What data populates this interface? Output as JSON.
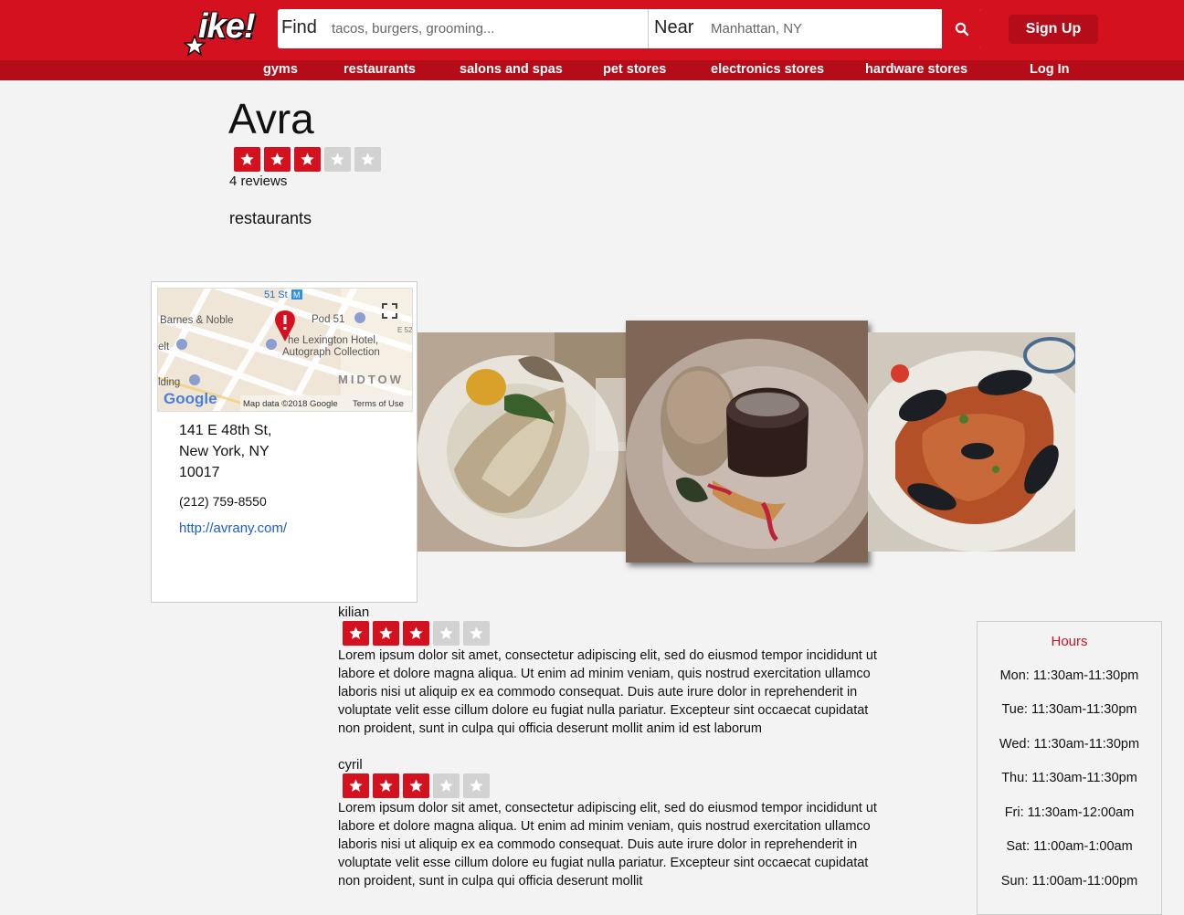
{
  "colors": {
    "brand_red": "#d4121f",
    "dark_red": "#b40d19",
    "star_off": "#d2d2d2",
    "link_blue": "#1a5fc7"
  },
  "header": {
    "logo_text": "ike!",
    "find_label": "Find",
    "find_placeholder": "tacos, burgers, grooming...",
    "near_label": "Near",
    "near_placeholder": "Manhattan, NY",
    "search_icon": "search-icon",
    "signup_label": "Sign Up"
  },
  "nav": {
    "items": [
      "gyms",
      "restaurants",
      "salons and spas",
      "pet stores",
      "electronics stores",
      "hardware stores"
    ],
    "login_label": "Log In"
  },
  "business": {
    "name": "Avra",
    "rating": 3,
    "rating_max": 5,
    "reviews_count": "4 reviews",
    "category": "restaurants",
    "address_line1": "141 E 48th St,",
    "address_line2": "New York, NY",
    "address_line3": "10017",
    "phone": "(212) 759-8550",
    "website": "http://avrany.com/"
  },
  "map": {
    "labels": {
      "street": "51 St",
      "store": "Barnes & Noble",
      "pod": "Pod 51",
      "hotel_line1": "he Lexington Hotel,",
      "hotel_line2": "Autograph Collection",
      "area": "MIDTOW",
      "left1": "elt",
      "left2": "lding",
      "e52": "E 52",
      "google": "Google",
      "attribution": "Map data ©2018 Google",
      "terms": "Terms of Use",
      "metro": "M"
    }
  },
  "photos": [
    {
      "name": "fish-dish-photo"
    },
    {
      "name": "lava-cake-photo"
    },
    {
      "name": "seafood-pasta-photo"
    }
  ],
  "reviews": [
    {
      "user": "kilian",
      "rating": 3,
      "text": "Lorem ipsum dolor sit amet, consectetur adipiscing elit, sed do eiusmod tempor incididunt ut labore et dolore magna aliqua. Ut enim ad minim veniam, quis nostrud exercitation ullamco laboris nisi ut aliquip ex ea commodo consequat. Duis aute irure dolor in reprehenderit in voluptate velit esse cillum dolore eu fugiat nulla pariatur. Excepteur sint occaecat cupidatat non proident, sunt in culpa qui officia deserunt mollit anim id est laborum"
    },
    {
      "user": "cyril",
      "rating": 3,
      "text": "Lorem ipsum dolor sit amet, consectetur adipiscing elit, sed do eiusmod tempor incididunt ut labore et dolore magna aliqua. Ut enim ad minim veniam, quis nostrud exercitation ullamco laboris nisi ut aliquip ex ea commodo consequat. Duis aute irure dolor in reprehenderit in voluptate velit esse cillum dolore eu fugiat nulla pariatur. Excepteur sint occaecat cupidatat non proident, sunt in culpa qui officia deserunt mollit"
    }
  ],
  "hours": {
    "title": "Hours",
    "days": [
      "Mon: 11:30am-11:30pm",
      "Tue: 11:30am-11:30pm",
      "Wed: 11:30am-11:30pm",
      "Thu: 11:30am-11:30pm",
      "Fri: 11:30am-12:00am",
      "Sat: 11:00am-1:00am",
      "Sun: 11:00am-11:00pm"
    ]
  }
}
